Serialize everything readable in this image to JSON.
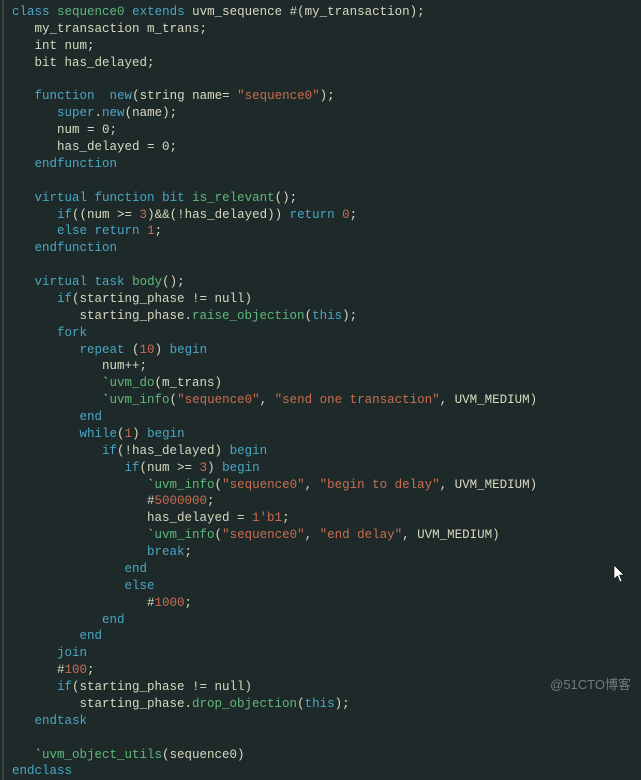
{
  "code": {
    "l1": {
      "class": "class",
      "name": "sequence0",
      "extends": "extends",
      "base": "uvm_sequence",
      "param": "#(my_transaction);"
    },
    "l2": "   my_transaction m_trans;",
    "l3": "   int num;",
    "l4": "   bit has_delayed;",
    "l5": "",
    "l6": {
      "kw1": "function",
      "kw2": "new",
      "args": "(string name= ",
      "str": "\"sequence0\"",
      "tail": ");"
    },
    "l7": {
      "pre": "      ",
      "call": "super",
      "dot": ".",
      "fn": "new",
      "args": "(name);"
    },
    "l8": "      num = 0;",
    "l9": "      has_delayed = 0;",
    "l10": {
      "kw": "endfunction"
    },
    "l11": "",
    "l12": {
      "kw1": "virtual",
      "kw2": "function",
      "kw3": "bit",
      "fn": "is_relevant",
      "tail": "();"
    },
    "l13": {
      "pre": "      ",
      "kw": "if",
      "cond": "((num >= ",
      "n1": "3",
      "mid": ")&&(!has_delayed)) ",
      "ret": "return",
      "sp": " ",
      "n2": "0",
      "tail": ";"
    },
    "l14": {
      "pre": "      ",
      "kw": "else",
      "sp": " ",
      "ret": "return",
      "sp2": " ",
      "n": "1",
      "tail": ";"
    },
    "l15": {
      "kw": "endfunction"
    },
    "l16": "",
    "l17": {
      "kw1": "virtual",
      "kw2": "task",
      "fn": "body",
      "tail": "();"
    },
    "l18": {
      "pre": "      ",
      "kw": "if",
      "cond": "(starting_phase != null)"
    },
    "l19": {
      "pre": "         starting_phase.",
      "fn": "raise_objection",
      "args": "(",
      "kw": "this",
      "tail": ");"
    },
    "l20": {
      "pre": "      ",
      "kw": "fork"
    },
    "l21": {
      "pre": "         ",
      "kw": "repeat",
      "sp": " (",
      "n": "10",
      "tail": ") ",
      "kw2": "begin"
    },
    "l22": "            num++;",
    "l23": {
      "pre": "            `",
      "fn": "uvm_do",
      "args": "(m_trans)"
    },
    "l24": {
      "pre": "            `",
      "fn": "uvm_info",
      "p": "(",
      "s1": "\"sequence0\"",
      "c1": ", ",
      "s2": "\"send one transaction\"",
      "c2": ", UVM_MEDIUM)"
    },
    "l25": {
      "pre": "         ",
      "kw": "end"
    },
    "l26": {
      "pre": "         ",
      "kw": "while",
      "args": "(",
      "n": "1",
      "tail": ") ",
      "kw2": "begin"
    },
    "l27": {
      "pre": "            ",
      "kw": "if",
      "cond": "(!has_delayed) ",
      "kw2": "begin"
    },
    "l28": {
      "pre": "               ",
      "kw": "if",
      "cond": "(num >= ",
      "n": "3",
      "tail": ") ",
      "kw2": "begin"
    },
    "l29": {
      "pre": "                  `",
      "fn": "uvm_info",
      "p": "(",
      "s1": "\"sequence0\"",
      "c1": ", ",
      "s2": "\"begin to delay\"",
      "c2": ", UVM_MEDIUM)"
    },
    "l30": {
      "pre": "                  #",
      "n": "5000000",
      "tail": ";"
    },
    "l31": {
      "pre": "                  has_delayed = ",
      "n": "1'b1",
      "tail": ";"
    },
    "l32": {
      "pre": "                  `",
      "fn": "uvm_info",
      "p": "(",
      "s1": "\"sequence0\"",
      "c1": ", ",
      "s2": "\"end delay\"",
      "c2": ", UVM_MEDIUM)"
    },
    "l33": {
      "pre": "                  ",
      "kw": "break",
      "tail": ";"
    },
    "l34": {
      "pre": "               ",
      "kw": "end"
    },
    "l35": {
      "pre": "               ",
      "kw": "else"
    },
    "l36": {
      "pre": "                  #",
      "n": "1000",
      "tail": ";"
    },
    "l37": {
      "pre": "            ",
      "kw": "end"
    },
    "l38": {
      "pre": "         ",
      "kw": "end"
    },
    "l39": {
      "pre": "      ",
      "kw": "join"
    },
    "l40": {
      "pre": "      #",
      "n": "100",
      "tail": ";"
    },
    "l41": {
      "pre": "      ",
      "kw": "if",
      "cond": "(starting_phase != null)"
    },
    "l42": {
      "pre": "         starting_phase.",
      "fn": "drop_objection",
      "args": "(",
      "kw": "this",
      "tail": ");"
    },
    "l43": {
      "kw": "endtask"
    },
    "l44": "",
    "l45": {
      "pre": "   `",
      "fn": "uvm_object_utils",
      "args": "(sequence0)"
    },
    "l46": {
      "kw": "endclass"
    }
  },
  "watermark": "@51CTO博客"
}
